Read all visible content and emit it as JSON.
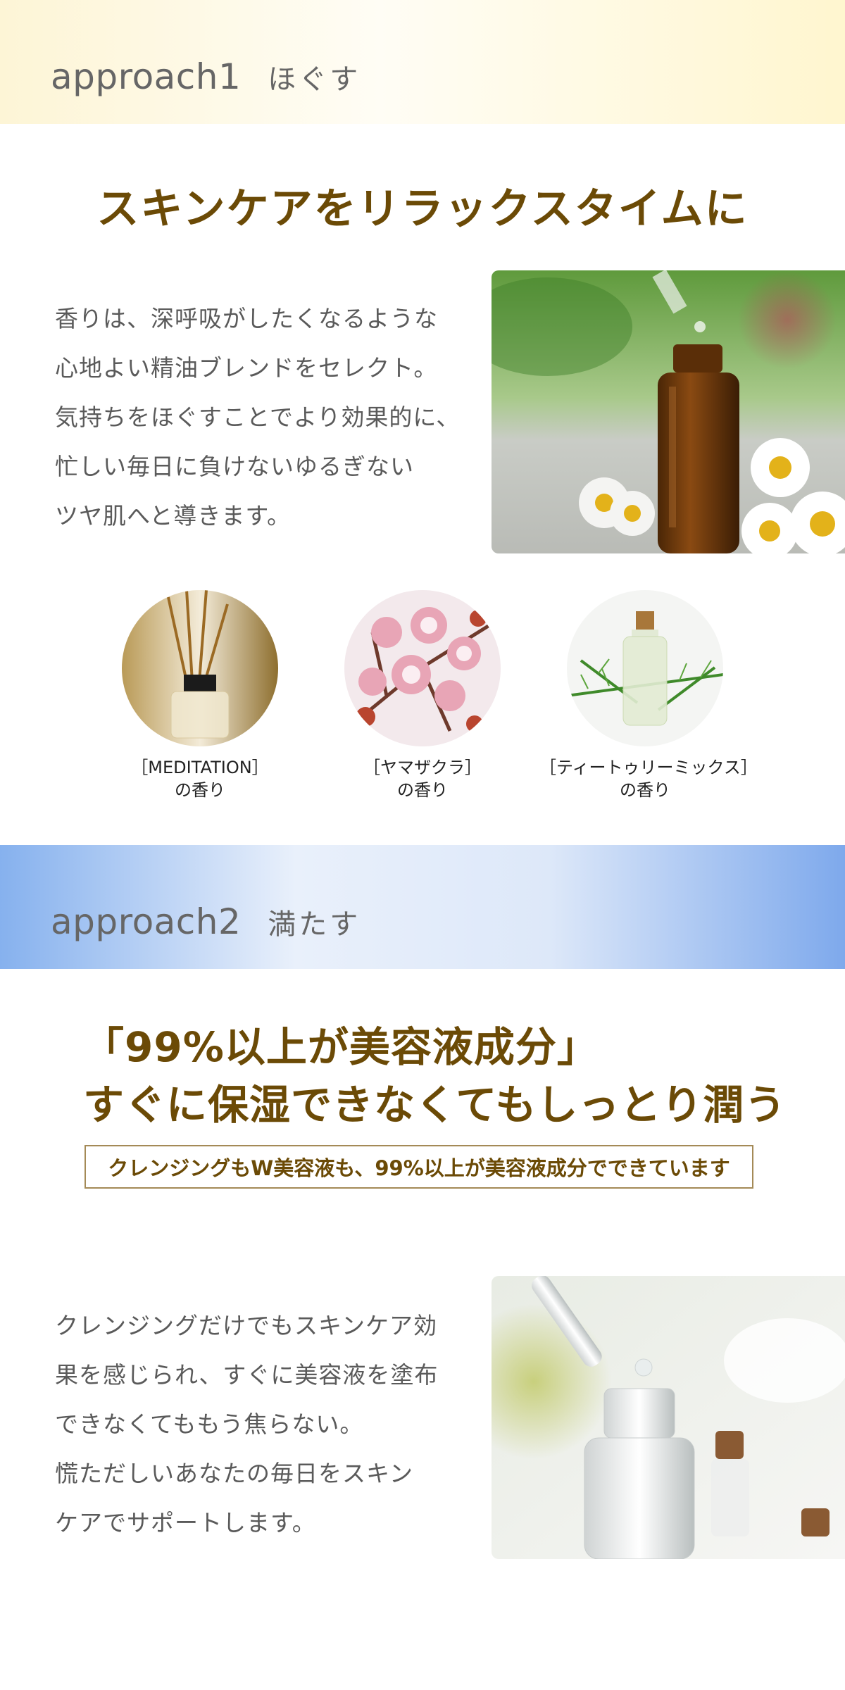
{
  "approach1": {
    "label_en": "approach1",
    "label_jp": "ほぐす",
    "headline": "スキンケアをリラックスタイムに",
    "body_lines": [
      "香りは、深呼吸がしたくなるような",
      "心地よい精油ブレンドをセレクト。",
      "気持ちをほぐすことでより効果的に、",
      "忙しい毎日に負けないゆるぎない",
      "ツヤ肌へと導きます。"
    ],
    "scents": [
      {
        "name": "［MEDITATION］",
        "suffix": "の香り",
        "icon": "reed-diffuser"
      },
      {
        "name": "［ヤマザクラ］",
        "suffix": "の香り",
        "icon": "cherry-blossom"
      },
      {
        "name": "［ティートゥリーミックス］",
        "suffix": "の香り",
        "icon": "tea-tree-oil"
      }
    ]
  },
  "approach2": {
    "label_en": "approach2",
    "label_jp": "満たす",
    "headline_line1": "「99%以上が美容液成分」",
    "headline_line2": "すぐに保湿できなくてもしっとり潤う",
    "tagline": "クレンジングもW美容液も、99%以上が美容液成分でできています",
    "body_lines": [
      "クレンジングだけでもスキンケア効",
      "果を感じられ、すぐに美容液を塗布",
      "できなくてももう焦らない。",
      "慌ただしいあなたの毎日をスキン",
      "ケアでサポートします。"
    ]
  },
  "colors": {
    "headline": "#6b4a06",
    "band1": "#fff6cf",
    "band2": "#7ea9ec",
    "body_text": "#5a5a5a"
  }
}
